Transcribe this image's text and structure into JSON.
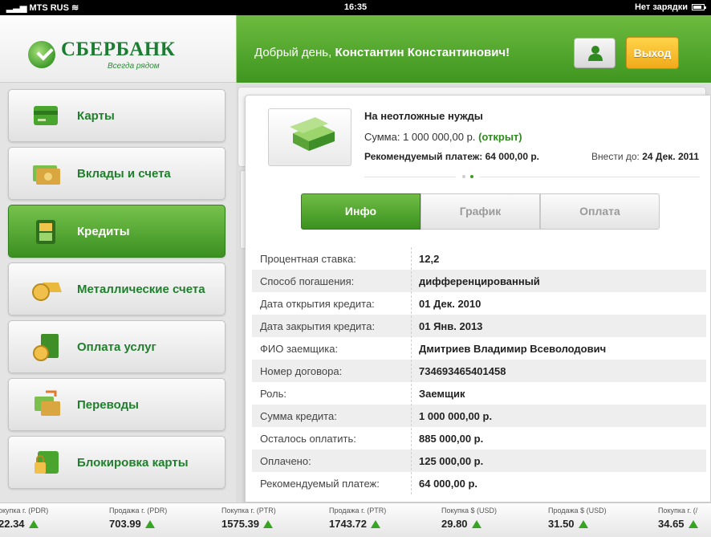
{
  "status_bar": {
    "carrier": "MTS RUS",
    "time": "16:35",
    "battery_text": "Нет зарядки"
  },
  "logo": {
    "name": "СБЕРБАНК",
    "tagline": "Всегда рядом"
  },
  "header": {
    "greeting_prefix": "Добрый день,",
    "user_name": "Константин Константинович!",
    "logout_label": "Выход"
  },
  "sidebar": {
    "items": [
      {
        "label": "Карты",
        "icon": "card-icon"
      },
      {
        "label": "Вклады и счета",
        "icon": "banknotes-icon"
      },
      {
        "label": "Кредиты",
        "icon": "wallet-icon",
        "active": true
      },
      {
        "label": "Металлические счета",
        "icon": "gold-coin-icon"
      },
      {
        "label": "Оплата услуг",
        "icon": "bill-payment-icon"
      },
      {
        "label": "Переводы",
        "icon": "transfer-icon"
      },
      {
        "label": "Блокировка карты",
        "icon": "lock-card-icon"
      }
    ]
  },
  "loan": {
    "title": "На неотложные нужды",
    "sum_label": "Сумма: 1 000 000,00 р.",
    "status": "(открыт)",
    "recommended_payment": "Рекомендуемый платеж: 64 000,00 р.",
    "due_label": "Внести до:",
    "due_date": "24 Дек. 2011",
    "page_indicator": {
      "pages": 2,
      "current": 2
    }
  },
  "tabs": [
    {
      "label": "Инфо",
      "active": true
    },
    {
      "label": "График",
      "active": false
    },
    {
      "label": "Оплата",
      "active": false
    }
  ],
  "details": [
    {
      "key": "Процентная ставка:",
      "value": "12,2"
    },
    {
      "key": "Способ погашения:",
      "value": "дифференцированный"
    },
    {
      "key": "Дата открытия кредита:",
      "value": "01 Дек. 2010"
    },
    {
      "key": "Дата закрытия кредита:",
      "value": "01 Янв. 2013"
    },
    {
      "key": "ФИО заемщика:",
      "value": "Дмитриев Владимир Всеволодович"
    },
    {
      "key": "Номер договора:",
      "value": "734693465401458"
    },
    {
      "key": "Роль:",
      "value": "Заемщик"
    },
    {
      "key": "Сумма кредита:",
      "value": "1 000 000,00 р."
    },
    {
      "key": "Осталось оплатить:",
      "value": "885 000,00 р."
    },
    {
      "key": "Оплачено:",
      "value": "125 000,00 р."
    },
    {
      "key": "Рекомендуемый платеж:",
      "value": "64 000,00 р."
    }
  ],
  "ticker": [
    {
      "title": "окупка г. (PDR)",
      "value": "22.34"
    },
    {
      "title": "Продажа г. (PDR)",
      "value": "703.99"
    },
    {
      "title": "Покупка г. (PTR)",
      "value": "1575.39"
    },
    {
      "title": "Продажа г. (PTR)",
      "value": "1743.72"
    },
    {
      "title": "Покупка $ (USD)",
      "value": "29.80"
    },
    {
      "title": "Продажа $ (USD)",
      "value": "31.50"
    },
    {
      "title": "Покупка г. (/",
      "value": "34.65"
    }
  ],
  "colors": {
    "brand_green": "#3f9620",
    "accent_yellow": "#f0a91a",
    "text_green": "#1f7f2c"
  }
}
